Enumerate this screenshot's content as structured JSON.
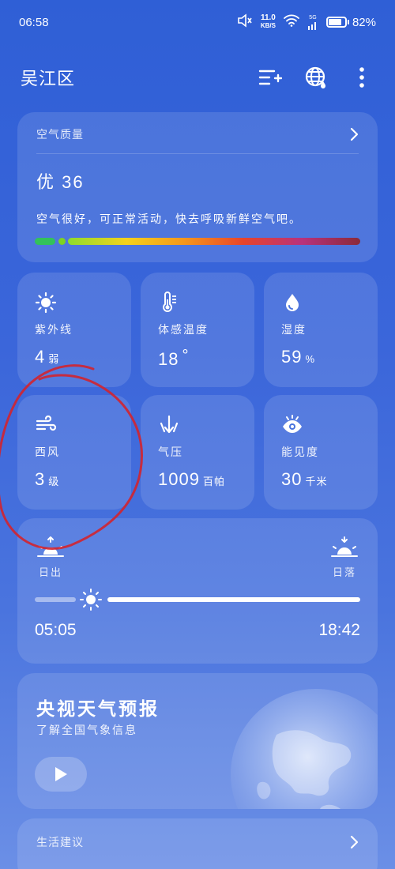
{
  "status": {
    "time": "06:58",
    "speed_value": "11.0",
    "speed_unit": "KB/S",
    "network": "5G",
    "battery": "82%",
    "battery_level": 0.82
  },
  "header": {
    "location": "吴江区"
  },
  "air_quality": {
    "label": "空气质量",
    "value": "优 36",
    "description": "空气很好，可正常活动，快去呼吸新鲜空气吧。"
  },
  "tiles": [
    {
      "label": "紫外线",
      "value": "4",
      "unit": "弱",
      "icon": "sun-icon"
    },
    {
      "label": "体感温度",
      "value": "18",
      "unit": "°",
      "icon": "thermometer-icon"
    },
    {
      "label": "湿度",
      "value": "59",
      "unit": "%",
      "icon": "water-drop-icon"
    },
    {
      "label": "西风",
      "value": "3",
      "unit": "级",
      "icon": "wind-icon"
    },
    {
      "label": "气压",
      "value": "1009",
      "unit": "百帕",
      "icon": "pressure-icon"
    },
    {
      "label": "能见度",
      "value": "30",
      "unit": "千米",
      "icon": "eye-icon"
    }
  ],
  "sun": {
    "sunrise_label": "日出",
    "sunset_label": "日落",
    "sunrise_time": "05:05",
    "sunset_time": "18:42"
  },
  "tv": {
    "title": "央视天气预报",
    "subtitle": "了解全国气象信息"
  },
  "life": {
    "label": "生活建议"
  },
  "colors": {
    "background": "#3b66da",
    "card": "rgba(255,255,255,0.12)",
    "aqi_good": "#33c25a"
  }
}
